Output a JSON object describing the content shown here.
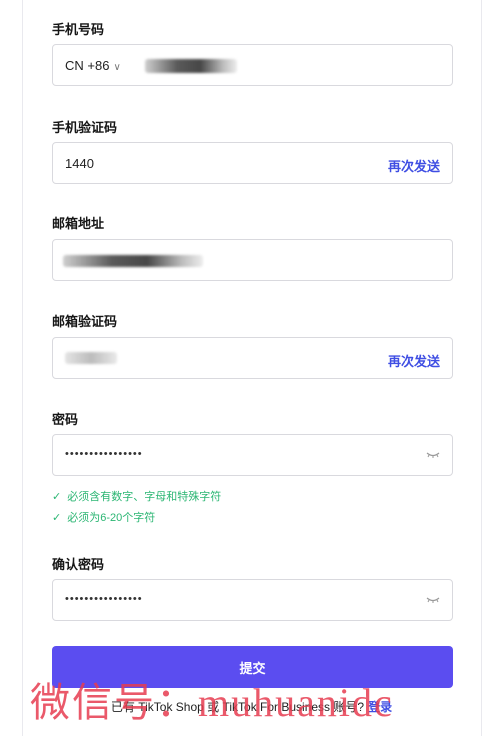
{
  "form": {
    "phone": {
      "label": "手机号码",
      "country_code": "CN +86"
    },
    "phone_code": {
      "label": "手机验证码",
      "value": "1440",
      "resend": "再次发送"
    },
    "email": {
      "label": "邮箱地址"
    },
    "email_code": {
      "label": "邮箱验证码",
      "resend": "再次发送"
    },
    "password": {
      "label": "密码",
      "masked": "••••••••••••••••",
      "rules": [
        "必须含有数字、字母和特殊字符",
        "必须为6-20个字符"
      ]
    },
    "confirm_password": {
      "label": "确认密码",
      "masked": "••••••••••••••••"
    },
    "submit_label": "提交"
  },
  "footer": {
    "text": "已有 TikTok Shop 或 TikTok For Business 账号?",
    "login": "登录"
  },
  "overlay": {
    "watermark": "微信号：muhuanidc"
  },
  "colors": {
    "accent": "#5b4df0",
    "link": "#3f4ee3",
    "success": "#2bb673"
  }
}
